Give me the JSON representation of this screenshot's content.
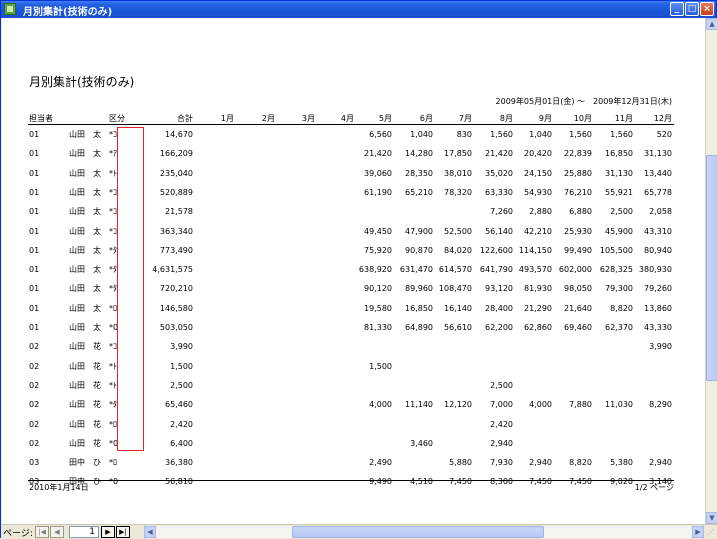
{
  "window": {
    "title": "月別集計(技術のみ)",
    "min_glyph": "_",
    "max_glyph": "□",
    "close_glyph": "×"
  },
  "report": {
    "title": "月別集計(技術のみ)",
    "date_range": "2009年05月01日(金) ～　2009年12月31日(木)",
    "headers": [
      "担当者",
      "区分",
      "合計",
      "1月",
      "2月",
      "3月",
      "4月",
      "5月",
      "6月",
      "7月",
      "8月",
      "9月",
      "10月",
      "11月",
      "12月"
    ],
    "rows": [
      {
        "code": "01",
        "name": "山田　太",
        "cat": "*ｺ",
        "total": "14,670",
        "m": [
          "",
          "",
          "",
          "",
          "6,560",
          "1,040",
          "830",
          "1,560",
          "1,040",
          "1,560",
          "1,560",
          "520"
        ]
      },
      {
        "code": "01",
        "name": "山田　太",
        "cat": "*ｱ",
        "total": "166,209",
        "m": [
          "",
          "",
          "",
          "",
          "21,420",
          "14,280",
          "17,850",
          "21,420",
          "20,420",
          "22,839",
          "16,850",
          "31,130"
        ]
      },
      {
        "code": "01",
        "name": "山田　太",
        "cat": "*ﾄ",
        "total": "235,040",
        "m": [
          "",
          "",
          "",
          "",
          "39,060",
          "28,350",
          "38,010",
          "35,020",
          "24,150",
          "25,880",
          "31,130",
          "13,440"
        ]
      },
      {
        "code": "01",
        "name": "山田　太",
        "cat": "*ｺ",
        "total": "520,889",
        "m": [
          "",
          "",
          "",
          "",
          "61,190",
          "65,210",
          "78,320",
          "63,330",
          "54,930",
          "76,210",
          "55,921",
          "65,778"
        ]
      },
      {
        "code": "01",
        "name": "山田　太",
        "cat": "*ｺ",
        "total": "21,578",
        "m": [
          "",
          "",
          "",
          "",
          "",
          "",
          "",
          "7,260",
          "2,880",
          "6,880",
          "2,500",
          "2,058"
        ]
      },
      {
        "code": "01",
        "name": "山田　太",
        "cat": "*ｺ",
        "total": "363,340",
        "m": [
          "",
          "",
          "",
          "",
          "49,450",
          "47,900",
          "52,500",
          "56,140",
          "42,210",
          "25,930",
          "45,900",
          "43,310"
        ]
      },
      {
        "code": "01",
        "name": "山田　太",
        "cat": "*ﾀ",
        "total": "773,490",
        "m": [
          "",
          "",
          "",
          "",
          "75,920",
          "90,870",
          "84,020",
          "122,600",
          "114,150",
          "99,490",
          "105,500",
          "80,940"
        ]
      },
      {
        "code": "01",
        "name": "山田　太",
        "cat": "*ﾀ",
        "total": "4,631,575",
        "m": [
          "",
          "",
          "",
          "",
          "638,920",
          "631,470",
          "614,570",
          "641,790",
          "493,570",
          "602,000",
          "628,325",
          "380,930"
        ]
      },
      {
        "code": "01",
        "name": "山田　太",
        "cat": "*ﾀ",
        "total": "720,210",
        "m": [
          "",
          "",
          "",
          "",
          "90,120",
          "89,960",
          "108,470",
          "93,120",
          "81,930",
          "98,050",
          "79,300",
          "79,260"
        ]
      },
      {
        "code": "01",
        "name": "山田　太",
        "cat": "*ﾛ",
        "total": "146,580",
        "m": [
          "",
          "",
          "",
          "",
          "19,580",
          "16,850",
          "16,140",
          "28,400",
          "21,290",
          "21,640",
          "8,820",
          "13,860"
        ]
      },
      {
        "code": "01",
        "name": "山田　太",
        "cat": "*0",
        "total": "503,050",
        "m": [
          "",
          "",
          "",
          "",
          "81,330",
          "64,890",
          "56,610",
          "62,200",
          "62,860",
          "69,460",
          "62,370",
          "43,330"
        ]
      },
      {
        "code": "02",
        "name": "山田　花",
        "cat": "*ｺ",
        "total": "3,990",
        "m": [
          "",
          "",
          "",
          "",
          "",
          "",
          "",
          "",
          "",
          "",
          "",
          "3,990"
        ]
      },
      {
        "code": "02",
        "name": "山田　花",
        "cat": "*ﾄ",
        "total": "1,500",
        "m": [
          "",
          "",
          "",
          "",
          "1,500",
          "",
          "",
          "",
          "",
          "",
          "",
          ""
        ]
      },
      {
        "code": "02",
        "name": "山田　花",
        "cat": "*ﾄ",
        "total": "2,500",
        "m": [
          "",
          "",
          "",
          "",
          "",
          "",
          "",
          "2,500",
          "",
          "",
          "",
          ""
        ]
      },
      {
        "code": "02",
        "name": "山田　花",
        "cat": "*ﾀ",
        "total": "65,460",
        "m": [
          "",
          "",
          "",
          "",
          "4,000",
          "11,140",
          "12,120",
          "7,000",
          "4,000",
          "7,880",
          "11,030",
          "8,290"
        ]
      },
      {
        "code": "02",
        "name": "山田　花",
        "cat": "*ﾛ",
        "total": "2,420",
        "m": [
          "",
          "",
          "",
          "",
          "",
          "",
          "",
          "2,420",
          "",
          "",
          "",
          ""
        ]
      },
      {
        "code": "02",
        "name": "山田　花",
        "cat": "*0",
        "total": "6,400",
        "m": [
          "",
          "",
          "",
          "",
          "",
          "3,460",
          "",
          "2,940",
          "",
          "",
          "",
          ""
        ]
      },
      {
        "code": "03",
        "name": "田中　ひ",
        "cat": "*ﾛ",
        "total": "36,380",
        "m": [
          "",
          "",
          "",
          "",
          "2,490",
          "",
          "5,880",
          "7,930",
          "2,940",
          "8,820",
          "5,380",
          "2,940"
        ]
      },
      {
        "code": "03",
        "name": "田中　ひ",
        "cat": "*0",
        "total": "56,810",
        "m": [
          "",
          "",
          "",
          "",
          "9,490",
          "4,510",
          "7,450",
          "8,300",
          "7,450",
          "7,450",
          "9,020",
          "3,140"
        ]
      }
    ],
    "footer_date": "2010年1月14日",
    "footer_page": "1/2 ページ"
  },
  "nav": {
    "label": "ページ:",
    "first": "|◀",
    "prev": "◀",
    "page_value": "1",
    "next": "▶",
    "last": "▶|"
  },
  "scroll": {
    "up": "▲",
    "down": "▼",
    "left": "◀",
    "right": "▶",
    "grip": "⋰"
  },
  "colors": {
    "titlebar": "#2461e3",
    "highlight_box": "#e0262b"
  }
}
